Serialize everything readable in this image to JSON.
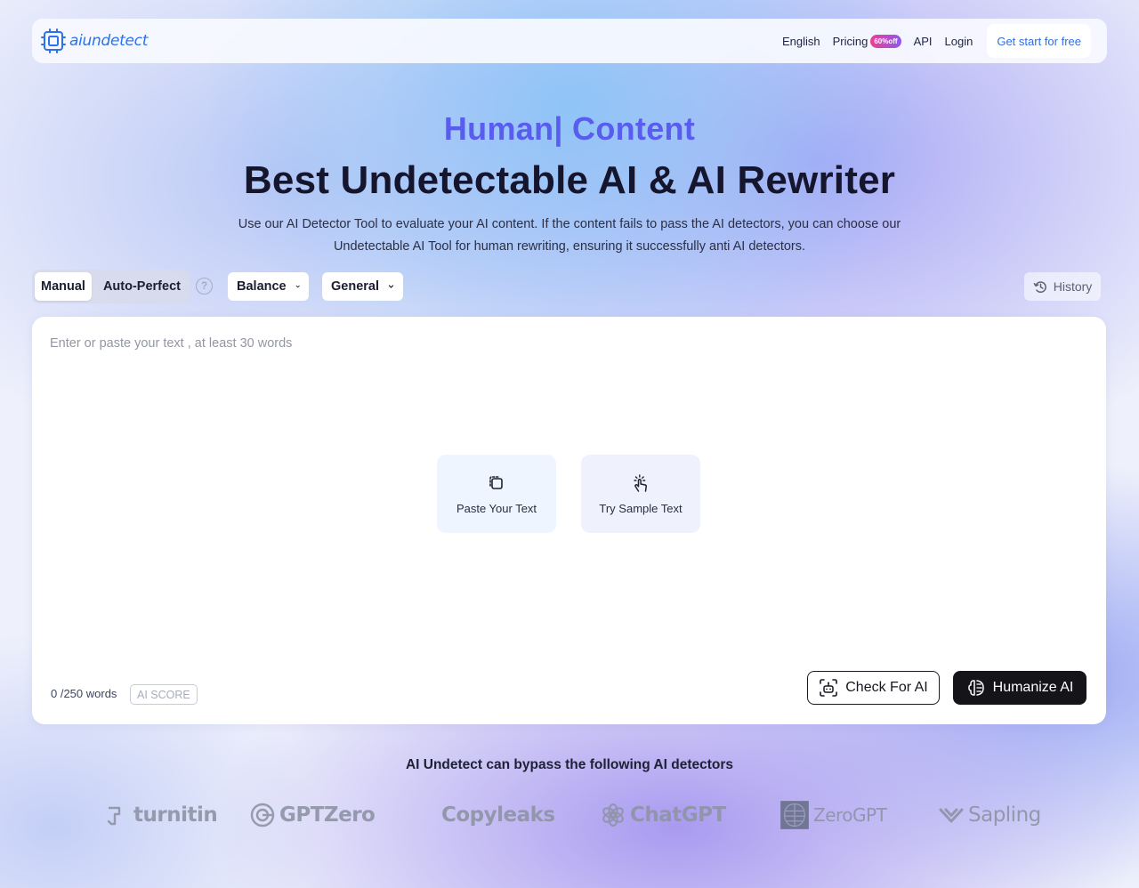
{
  "header": {
    "logo_text": "aiundetect",
    "nav": {
      "language": "English",
      "pricing": "Pricing",
      "pricing_badge": "60%off",
      "api": "API",
      "login": "Login",
      "cta": "Get start for free"
    }
  },
  "hero": {
    "subtitle": "Human| Content",
    "title": "Best Undetectable AI & AI Rewriter",
    "description": "Use our AI Detector Tool to evaluate your AI content. If the content fails to pass the AI detectors, you can choose our Undetectable AI Tool for human rewriting, ensuring it successfully anti AI detectors."
  },
  "toolbar": {
    "modes": [
      "Manual",
      "Auto-Perfect"
    ],
    "active_mode": "Manual",
    "help_symbol": "?",
    "strength": "Balance",
    "purpose": "General",
    "history": "History"
  },
  "editor": {
    "placeholder": "Enter or paste your text , at least 30 words",
    "paste_label": "Paste Your Text",
    "sample_label": "Try Sample Text",
    "word_count": "0 /250 words",
    "ai_score": "AI SCORE",
    "check_label": "Check For AI",
    "humanize_label": "Humanize AI"
  },
  "detectors": {
    "title": "AI Undetect can bypass the following AI detectors",
    "items": [
      {
        "name": "turnitin",
        "icon": "turnitin-icon"
      },
      {
        "name": "GPTZero",
        "icon": "gptzero-icon"
      },
      {
        "name": "Copyleaks",
        "icon": "copyleaks-icon"
      },
      {
        "name": "ChatGPT",
        "icon": "chatgpt-icon"
      },
      {
        "name": "ZeroGPT",
        "icon": "zerogpt-icon"
      },
      {
        "name": "Sapling",
        "icon": "sapling-icon"
      }
    ]
  },
  "colors": {
    "accent": "#5a5cf0",
    "link": "#2f6fe0",
    "dark_button": "#141419",
    "badge_from": "#ec3f8f",
    "badge_to": "#8e58f3"
  }
}
